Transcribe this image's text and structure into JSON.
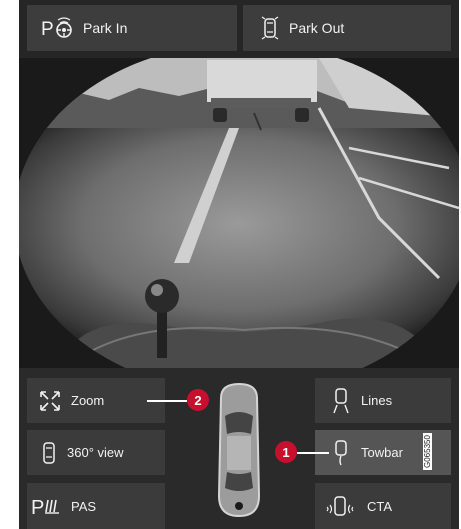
{
  "top_bar": {
    "park_in_label": "Park In",
    "park_out_label": "Park Out"
  },
  "bottom_panel": {
    "zoom_label": "Zoom",
    "view360_label": "360° view",
    "pas_label": "PAS",
    "lines_label": "Lines",
    "towbar_label": "Towbar",
    "cta_label": "CTA"
  },
  "callouts": {
    "one": "1",
    "two": "2"
  },
  "figure_id": "G065350",
  "colors": {
    "callout": "#c8102e",
    "button_bg": "#3b3b3b",
    "active_bg": "#555555"
  }
}
